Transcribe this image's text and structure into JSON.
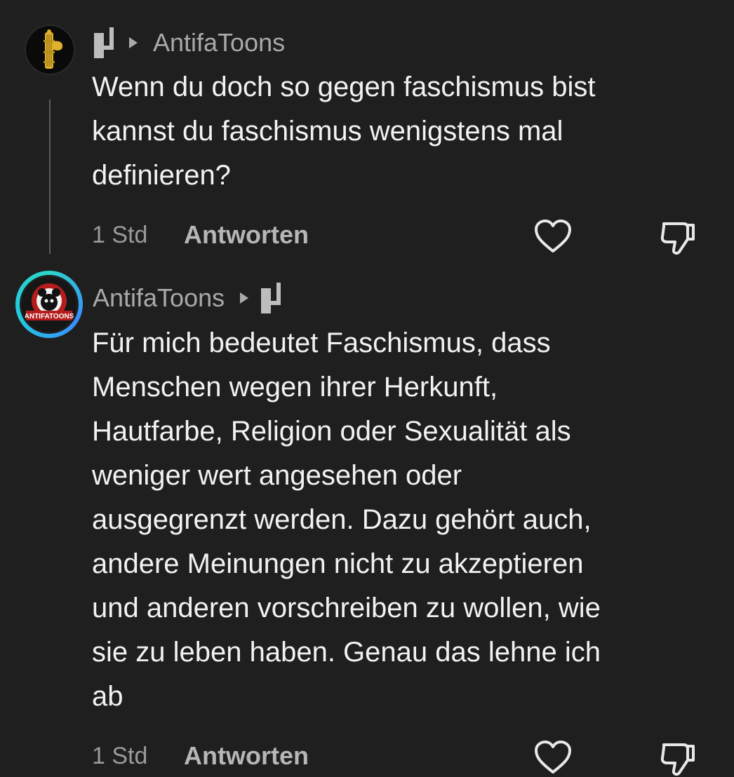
{
  "comments": [
    {
      "author": "",
      "reply_to": "AntifaToons",
      "text": "Wenn du doch so gegen faschismus bist\nkannst du faschismus wenigstens mal\ndefinieren?",
      "time": "1 Std",
      "reply_label": "Antworten",
      "avatar_icon": "fasces-icon"
    },
    {
      "author": "AntifaToons",
      "reply_to": "",
      "text": "Für mich bedeutet Faschismus, dass\nMenschen wegen ihrer Herkunft,\nHautfarbe, Religion oder Sexualität als\nweniger wert angesehen oder\nausgegrenzt werden. Dazu gehört auch,\nandere Meinungen nicht zu akzeptieren\nund anderen vorschreiben zu wollen, wie\nsie zu leben haben. Genau das lehne ich\nab",
      "time": "1 Std",
      "reply_label": "Antworten",
      "avatar_text": "ANTIFATOONS"
    }
  ],
  "colors": {
    "background": "#1f1f1f",
    "text": "#f2f2f2",
    "muted": "#a9a9a9",
    "avatar_ring": "#2bd6c8"
  }
}
